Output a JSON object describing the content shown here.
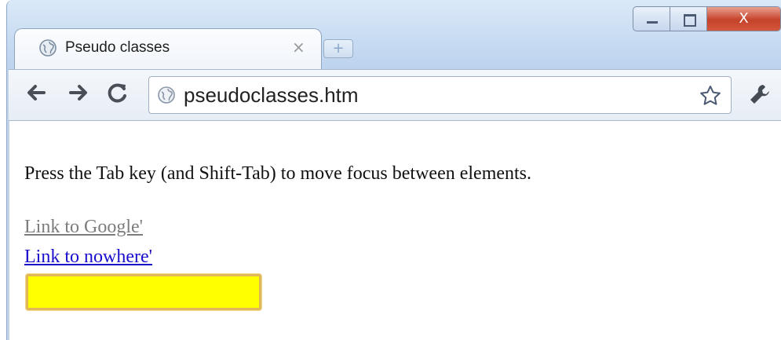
{
  "browser": {
    "tab_title": "Pseudo classes",
    "tab_close": "×",
    "new_tab": "+",
    "window_close": "X",
    "address": "pseudoclasses.htm",
    "icons": [
      "globe-icon",
      "back-arrow-icon",
      "forward-arrow-icon",
      "reload-icon",
      "star-icon",
      "wrench-icon"
    ]
  },
  "page": {
    "instructions": "Press the Tab key (and Shift-Tab) to move focus between elements.",
    "link_google": "Link to Google'",
    "link_nowhere": "Link to nowhere'",
    "input_value": "",
    "input_background": "#ffff00",
    "visited_link_color": "#7c7c7c",
    "link_color": "#1a0dcc"
  }
}
